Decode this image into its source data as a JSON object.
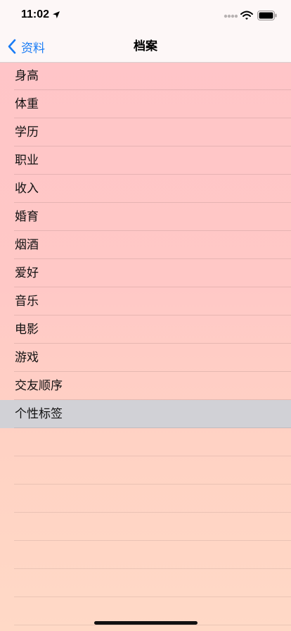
{
  "status_bar": {
    "time": "11:02",
    "icons": [
      "location-arrow-icon",
      "cellular-signal-icon",
      "wifi-icon",
      "battery-icon"
    ]
  },
  "nav": {
    "back_label": "资料",
    "title": "档案"
  },
  "list": {
    "items": [
      {
        "label": "身高"
      },
      {
        "label": "体重"
      },
      {
        "label": "学历"
      },
      {
        "label": "职业"
      },
      {
        "label": "收入"
      },
      {
        "label": "婚育"
      },
      {
        "label": "烟酒"
      },
      {
        "label": "爱好"
      },
      {
        "label": "音乐"
      },
      {
        "label": "电影"
      },
      {
        "label": "游戏"
      },
      {
        "label": "交友顺序"
      },
      {
        "label": "个性标签",
        "selected": true
      }
    ]
  },
  "colors": {
    "accent": "#1a7cf5",
    "selected_row": "#d1d1d6",
    "background_top": "#ffc4c8",
    "background_bottom": "#ffd9c6"
  }
}
